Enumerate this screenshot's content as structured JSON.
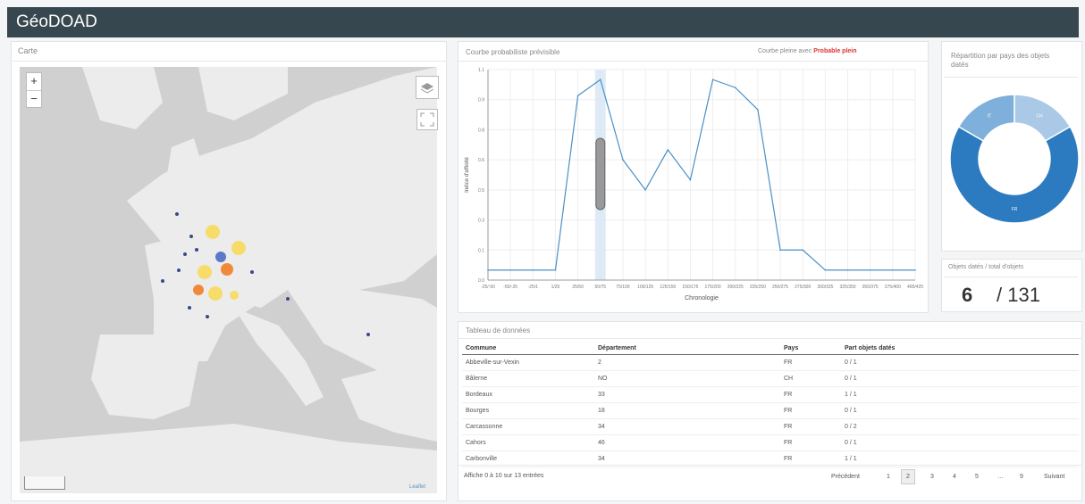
{
  "app": {
    "title": "GéoDOAD"
  },
  "map_panel": {
    "title": "Carte",
    "zoom_in": "+",
    "zoom_out": "−",
    "layers_icon": "layers-icon",
    "fullscreen_icon": "fullscreen-icon",
    "attribution": "Leaflet"
  },
  "chart_panel": {
    "title": "Courbe probabiliste prévisible",
    "note_prefix": "Courbe pleine avec",
    "note_link": "Probable plein"
  },
  "donut_panel": {
    "title": "Répartition par pays des objets datés"
  },
  "count_panel": {
    "title": "Objets datés / total d'objets",
    "value": "6",
    "total": "/ 131"
  },
  "table_panel": {
    "title": "Tableau de données",
    "columns": [
      "Commune",
      "Département",
      "Pays",
      "Part objets datés"
    ],
    "rows": [
      [
        "Abbeville-sur-Vexin",
        "2",
        "FR",
        "0 / 1"
      ],
      [
        "Bâlerne",
        "NO",
        "CH",
        "0 / 1"
      ],
      [
        "Bordeaux",
        "33",
        "FR",
        "1 / 1"
      ],
      [
        "Bourges",
        "18",
        "FR",
        "0 / 1"
      ],
      [
        "Carcassonne",
        "34",
        "FR",
        "0 / 2"
      ],
      [
        "Cahors",
        "46",
        "FR",
        "0 / 1"
      ],
      [
        "Carbonville",
        "34",
        "FR",
        "1 / 1"
      ]
    ],
    "info": "Affiche 0 à 10 sur 13 entrées",
    "pager": {
      "prev": "Précédent",
      "pages": [
        "1",
        "2",
        "3",
        "4",
        "5",
        "…",
        "9"
      ],
      "next": "Suivant"
    }
  },
  "colors": {
    "header": "#37474f",
    "line": "#4a90c8",
    "donut_dark": "#2c7bc0",
    "donut_light": "#a9c9e6",
    "donut_mid": "#7fb0db",
    "marker_orange": "#f08a3a",
    "marker_yellow": "#f7dc6a",
    "marker_blue": "#5a79c7"
  },
  "chart_data": {
    "type": "line",
    "title": "Courbe probabiliste prévisible",
    "xlabel": "Chronologie",
    "ylabel": "Indice d'affinité",
    "x": [
      "-25/-50",
      "-50/-25",
      "-25/1",
      "1/25",
      "25/50",
      "50/75",
      "75/100",
      "100/125",
      "125/150",
      "150/175",
      "175/200",
      "200/225",
      "225/250",
      "250/275",
      "275/300",
      "300/325",
      "325/350",
      "350/375",
      "375/400",
      "400/425"
    ],
    "values": [
      0.05,
      0.05,
      0.05,
      0.05,
      0.92,
      1.0,
      0.6,
      0.45,
      0.65,
      0.5,
      1.0,
      0.96,
      0.85,
      0.15,
      0.15,
      0.05,
      0.05,
      0.05,
      0.05,
      0.05
    ],
    "ylim": [
      0,
      1.05
    ],
    "grid": true,
    "series": [
      {
        "name": "Probable plein",
        "values": [
          0.05,
          0.05,
          0.05,
          0.05,
          0.92,
          1.0,
          0.6,
          0.45,
          0.65,
          0.5,
          1.0,
          0.96,
          0.85,
          0.15,
          0.15,
          0.05,
          0.05,
          0.05,
          0.05,
          0.05
        ]
      }
    ]
  },
  "donut_data": {
    "type": "pie",
    "slices": [
      {
        "label": "CH",
        "value": 1,
        "color": "#a9c9e6"
      },
      {
        "label": "FR",
        "value": 4,
        "color": "#2c7bc0"
      },
      {
        "label": "IT",
        "value": 1,
        "color": "#7fb0db"
      }
    ]
  }
}
